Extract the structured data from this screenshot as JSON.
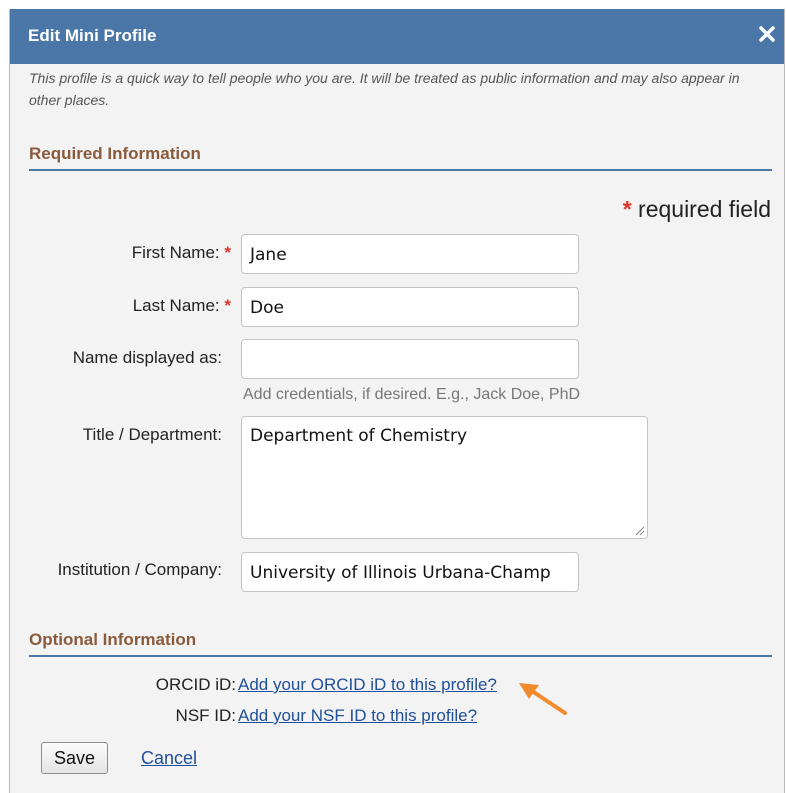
{
  "dialog": {
    "title": "Edit Mini Profile",
    "close_icon": "close-icon",
    "intro": "This profile is a quick way to tell people who you are. It will be treated as public information and may also appear in other places."
  },
  "required": {
    "heading": "Required Information",
    "legend_star": "*",
    "legend_text": "required field",
    "first_name": {
      "label": "First Name:",
      "star": "*",
      "value": "Jane"
    },
    "last_name": {
      "label": "Last Name:",
      "star": "*",
      "value": "Doe"
    },
    "display_name": {
      "label": "Name displayed as:",
      "value": "",
      "hint": "Add credentials, if desired. E.g., Jack Doe, PhD"
    },
    "title_department": {
      "label": "Title / Department:",
      "value": "Department of Chemistry"
    },
    "institution": {
      "label": "Institution / Company:",
      "value": "University of Illinois Urbana-Champ"
    }
  },
  "optional": {
    "heading": "Optional Information",
    "orcid": {
      "label": "ORCID iD:",
      "link": "Add your ORCID iD to this profile?"
    },
    "nsf": {
      "label": "NSF ID:",
      "link": "Add your NSF ID to this profile?"
    }
  },
  "actions": {
    "save_label": "Save",
    "cancel_label": "Cancel"
  },
  "annotation": {
    "arrow_color": "#f08a2c"
  },
  "colors": {
    "titlebar": "#4a76a8",
    "section_heading": "#8a5a3c",
    "required_star": "#e0322b",
    "link": "#1f4e9a"
  }
}
